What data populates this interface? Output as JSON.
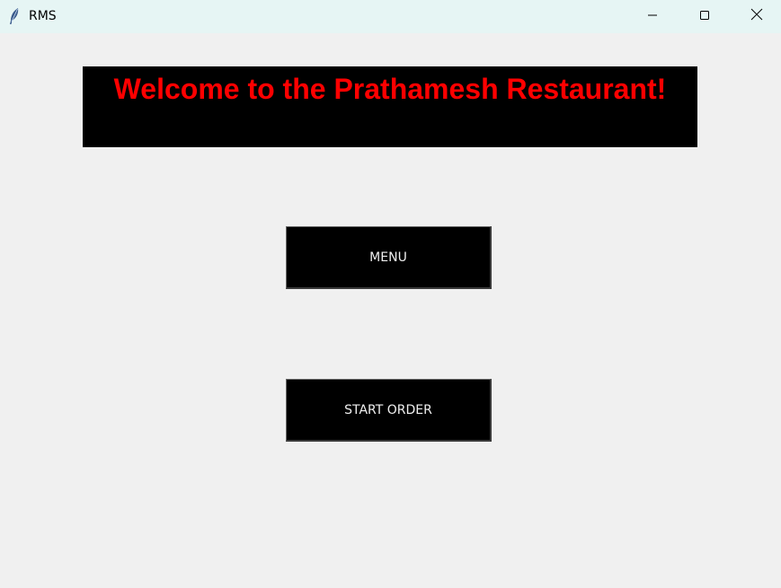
{
  "window": {
    "title": "RMS",
    "icon": "feather-icon",
    "controls": [
      "minimize-icon",
      "maximize-icon",
      "close-icon"
    ]
  },
  "banner": {
    "text": "Welcome to the Prathamesh Restaurant!",
    "text_color": "#ff0000",
    "background": "#000000"
  },
  "buttons": {
    "menu_label": "MENU",
    "start_order_label": "START ORDER",
    "background": "#000000",
    "text_color": "#f0f0f0"
  }
}
